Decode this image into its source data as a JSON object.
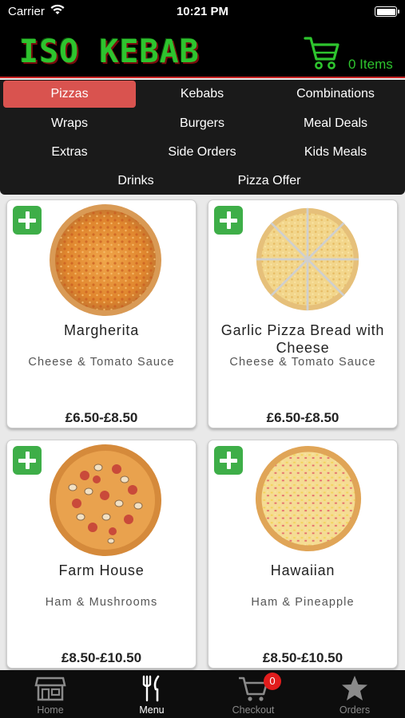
{
  "status_bar": {
    "carrier": "Carrier",
    "time": "10:21 PM"
  },
  "header": {
    "logo": "ISO KEBAB",
    "cart_count": "0 Items",
    "accent_color": "#2ec42e",
    "divider_color": "#c82323"
  },
  "categories": [
    {
      "label": "Pizzas",
      "active": true
    },
    {
      "label": "Kebabs"
    },
    {
      "label": "Combinations"
    },
    {
      "label": "Wraps"
    },
    {
      "label": "Burgers"
    },
    {
      "label": "Meal Deals"
    },
    {
      "label": "Extras"
    },
    {
      "label": "Side Orders"
    },
    {
      "label": "Kids Meals"
    },
    {
      "label": "Drinks"
    },
    {
      "label": "Pizza Offer"
    }
  ],
  "products": [
    {
      "name": "Margherita",
      "description": "Cheese & Tomato Sauce",
      "price": "£6.50-£8.50",
      "image": "margherita-pizza"
    },
    {
      "name": "Garlic Pizza Bread with Cheese",
      "description": "Cheese & Tomato Sauce",
      "price": "£6.50-£8.50",
      "image": "garlic-bread-pizza"
    },
    {
      "name": "Farm House",
      "description": "Ham & Mushrooms",
      "price": "£8.50-£10.50",
      "image": "farmhouse-pizza"
    },
    {
      "name": "Hawaiian",
      "description": "Ham & Pineapple",
      "price": "£8.50-£10.50",
      "image": "hawaiian-pizza"
    }
  ],
  "tabbar": {
    "items": [
      {
        "label": "Home",
        "icon": "store-icon"
      },
      {
        "label": "Menu",
        "icon": "cutlery-icon",
        "active": true
      },
      {
        "label": "Checkout",
        "icon": "cart-icon"
      },
      {
        "label": "Orders",
        "icon": "star-icon"
      }
    ],
    "checkout_badge": "0",
    "badge_color": "#e21d1d"
  },
  "active_category_color": "#d9534f",
  "add_button_color": "#3eae48"
}
